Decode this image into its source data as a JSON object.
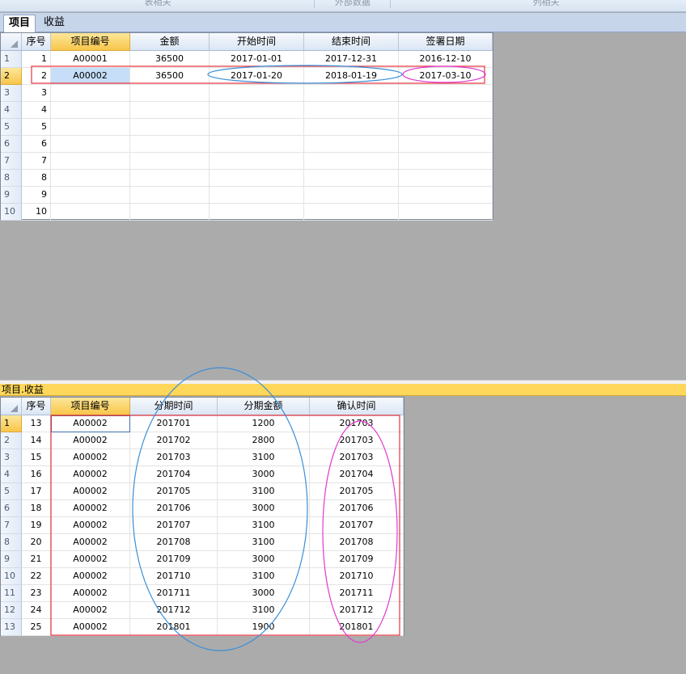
{
  "ribbon": {
    "groups": [
      "表相关",
      "外部数据",
      "列相关"
    ]
  },
  "tabs": [
    {
      "label": "项目",
      "active": true
    },
    {
      "label": "收益",
      "active": false
    }
  ],
  "projects": {
    "columns": [
      "序号",
      "项目编号",
      "金额",
      "开始时间",
      "结束时间",
      "签署日期"
    ],
    "row_numbers": [
      "1",
      "2",
      "3",
      "4",
      "5",
      "6",
      "7",
      "8",
      "9",
      "10"
    ],
    "rows": [
      [
        "1",
        "A00001",
        "36500",
        "2017-01-01",
        "2017-12-31",
        "2016-12-10"
      ],
      [
        "2",
        "A00002",
        "36500",
        "2017-01-20",
        "2018-01-19",
        "2017-03-10"
      ],
      [
        "3",
        "",
        "",
        "",
        "",
        ""
      ],
      [
        "4",
        "",
        "",
        "",
        "",
        ""
      ],
      [
        "5",
        "",
        "",
        "",
        "",
        ""
      ],
      [
        "6",
        "",
        "",
        "",
        "",
        ""
      ],
      [
        "7",
        "",
        "",
        "",
        "",
        ""
      ],
      [
        "8",
        "",
        "",
        "",
        "",
        ""
      ],
      [
        "9",
        "",
        "",
        "",
        "",
        ""
      ],
      [
        "10",
        "",
        "",
        "",
        "",
        ""
      ]
    ]
  },
  "subtable": {
    "title": "项目.收益",
    "columns": [
      "序号",
      "项目编号",
      "分期时间",
      "分期金额",
      "确认时间"
    ],
    "row_numbers": [
      "1",
      "2",
      "3",
      "4",
      "5",
      "6",
      "7",
      "8",
      "9",
      "10",
      "11",
      "12",
      "13"
    ],
    "rows": [
      [
        "13",
        "A00002",
        "201701",
        "1200",
        "201703"
      ],
      [
        "14",
        "A00002",
        "201702",
        "2800",
        "201703"
      ],
      [
        "15",
        "A00002",
        "201703",
        "3100",
        "201703"
      ],
      [
        "16",
        "A00002",
        "201704",
        "3000",
        "201704"
      ],
      [
        "17",
        "A00002",
        "201705",
        "3100",
        "201705"
      ],
      [
        "18",
        "A00002",
        "201706",
        "3000",
        "201706"
      ],
      [
        "19",
        "A00002",
        "201707",
        "3100",
        "201707"
      ],
      [
        "20",
        "A00002",
        "201708",
        "3100",
        "201708"
      ],
      [
        "21",
        "A00002",
        "201709",
        "3000",
        "201709"
      ],
      [
        "22",
        "A00002",
        "201710",
        "3100",
        "201710"
      ],
      [
        "23",
        "A00002",
        "201711",
        "3000",
        "201711"
      ],
      [
        "24",
        "A00002",
        "201712",
        "3100",
        "201712"
      ],
      [
        "25",
        "A00002",
        "201801",
        "1900",
        "201801"
      ]
    ]
  },
  "colors": {
    "annotation_red": "#e8323c",
    "annotation_blue": "#3a8fd8",
    "annotation_magenta": "#e03ad0",
    "selected_header": "#f8c64a",
    "subtable_title_bar": "#ffd75a"
  }
}
